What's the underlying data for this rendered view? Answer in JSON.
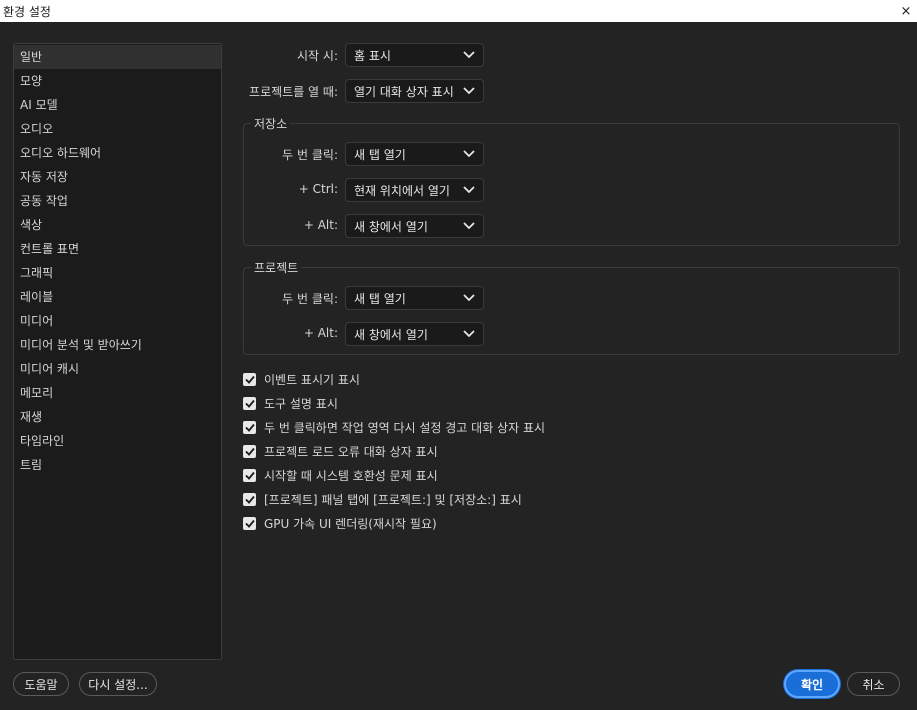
{
  "window": {
    "title": "환경 설정",
    "close_icon": "×"
  },
  "sidebar": {
    "items": [
      {
        "label": "일반"
      },
      {
        "label": "모양"
      },
      {
        "label": "AI 모델"
      },
      {
        "label": "오디오"
      },
      {
        "label": "오디오 하드웨어"
      },
      {
        "label": "자동 저장"
      },
      {
        "label": "공동 작업"
      },
      {
        "label": "색상"
      },
      {
        "label": "컨트롤 표면"
      },
      {
        "label": "그래픽"
      },
      {
        "label": "레이블"
      },
      {
        "label": "미디어"
      },
      {
        "label": "미디어 분석 및 받아쓰기"
      },
      {
        "label": "미디어 캐시"
      },
      {
        "label": "메모리"
      },
      {
        "label": "재생"
      },
      {
        "label": "타임라인"
      },
      {
        "label": "트림"
      }
    ],
    "selected": "일반"
  },
  "general": {
    "startup_label": "시작 시:",
    "startup_value": "홈 표시",
    "open_project_label": "프로젝트를 열 때:",
    "open_project_value": "열기 대화 상자 표시"
  },
  "storage": {
    "title": "저장소",
    "double_click_label": "두 번 클릭:",
    "double_click_value": "새 탭 열기",
    "ctrl_label": "+ Ctrl:",
    "ctrl_value": "현재 위치에서 열기",
    "alt_label": "+ Alt:",
    "alt_value": "새 창에서 열기"
  },
  "project": {
    "title": "프로젝트",
    "double_click_label": "두 번 클릭:",
    "double_click_value": "새 탭 열기",
    "alt_label": "+ Alt:",
    "alt_value": "새 창에서 열기"
  },
  "checkboxes": [
    {
      "label": "이벤트 표시기 표시",
      "checked": true
    },
    {
      "label": "도구 설명 표시",
      "checked": true
    },
    {
      "label": "두 번 클릭하면 작업 영역 다시 설정 경고 대화 상자 표시",
      "checked": true
    },
    {
      "label": "프로젝트 로드 오류 대화 상자 표시",
      "checked": true
    },
    {
      "label": "시작할 때 시스템 호환성 문제 표시",
      "checked": true
    },
    {
      "label": "[프로젝트] 패널 탭에 [프로젝트:] 및 [저장소:] 표시",
      "checked": true
    },
    {
      "label": "GPU 가속 UI 렌더링(재시작 필요)",
      "checked": true
    }
  ],
  "footer": {
    "help_label": "도움말",
    "reset_label": "다시 설정...",
    "ok_label": "확인",
    "cancel_label": "취소"
  },
  "colors": {
    "background": "#232323",
    "sidebar_bg": "#1b1b1b",
    "selected_item": "#303030",
    "primary_button": "#1a6ed8",
    "primary_border": "#5fa8ff"
  }
}
